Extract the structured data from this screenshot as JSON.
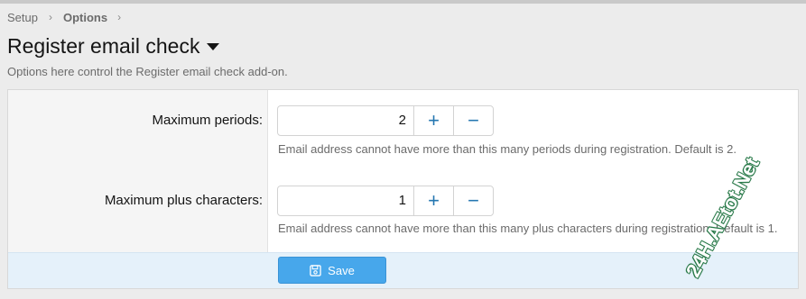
{
  "breadcrumb": {
    "items": [
      "Setup",
      "Options"
    ]
  },
  "page": {
    "title": "Register email check",
    "description": "Options here control the Register email check add-on."
  },
  "fields": [
    {
      "label": "Maximum periods:",
      "value": "2",
      "hint": "Email address cannot have more than this many periods during registration. Default is 2."
    },
    {
      "label": "Maximum plus characters:",
      "value": "1",
      "hint": "Email address cannot have more than this many plus characters during registration. Default is 1."
    }
  ],
  "stepper": {
    "plus": "+",
    "minus": "−"
  },
  "footer": {
    "save_label": "Save"
  },
  "watermark": "24H.AEtot.Net",
  "icons": {
    "save": "save-icon",
    "caret": "caret-down-icon",
    "chevron": "chevron-right-icon"
  },
  "colors": {
    "accent": "#47a7eb",
    "link": "#2577b1",
    "footer_bg": "#e5f1fa"
  }
}
